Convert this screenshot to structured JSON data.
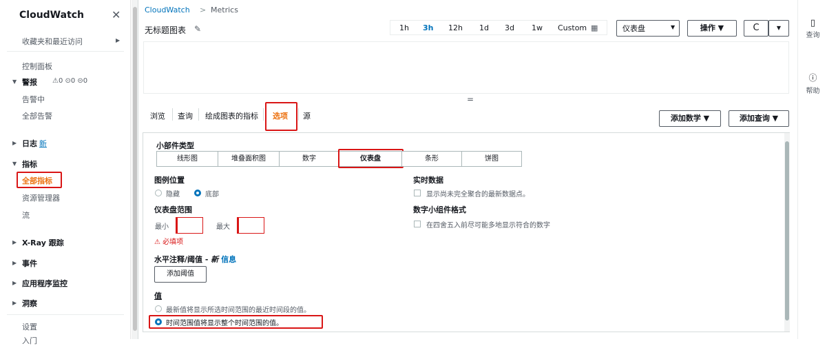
{
  "sidebar": {
    "title": "CloudWatch",
    "close": "✕",
    "favorites": "收藏夹和最近访问",
    "dashboard": "控制面板",
    "alarms": {
      "label": "警报",
      "counts": "⚠0 ⊙0 ⊝0"
    },
    "in_alarm": "告警中",
    "all_alarms": "全部告警",
    "logs": {
      "label": "日志",
      "badge": "新"
    },
    "metrics": "指标",
    "all_metrics": "全部指标",
    "explorer": "资源管理器",
    "streams": "流",
    "xray": "X-Ray 跟踪",
    "events": "事件",
    "app_monitoring": "应用程序监控",
    "insights": "洞察",
    "settings": "设置",
    "getting_started": "入门"
  },
  "breadcrumb": {
    "root": "CloudWatch",
    "separator": ">",
    "current": "Metrics"
  },
  "chart": {
    "title": "无标题图表",
    "edit_icon": "pencil-icon"
  },
  "timerange": {
    "options": [
      "1h",
      "3h",
      "12h",
      "1d",
      "3d",
      "1w",
      "Custom"
    ],
    "selected": "3h"
  },
  "toolbar": {
    "widget_select": "仪表盘",
    "actions": "操作 ▼",
    "refresh": "C",
    "refresh_dropdown": "▼"
  },
  "right_panel": {
    "query": "查询",
    "help": "帮助"
  },
  "resize_handle": "=",
  "tabs": [
    {
      "label": "浏览"
    },
    {
      "label": "查询"
    },
    {
      "label": "绘成图表的指标"
    },
    {
      "label": "选项"
    },
    {
      "label": "源"
    }
  ],
  "selected_tab": "选项",
  "add_math": "添加数学 ▼",
  "add_query": "添加查询 ▼",
  "options": {
    "widget_type_label": "小部件类型",
    "widget_types": [
      "线形图",
      "堆叠面积图",
      "数字",
      "仪表盘",
      "条形",
      "饼图"
    ],
    "selected_widget_type": "仪表盘",
    "legend_label": "图例位置",
    "legend_hidden": "隐藏",
    "legend_bottom": "底部",
    "gauge_range_label": "仪表盘范围",
    "min_label": "最小",
    "max_label": "最大",
    "required": "必填项",
    "annotation_label": "水平注释/阈值 - ",
    "annotation_new": "新",
    "annotation_info": "信息",
    "add_threshold": "添加阈值",
    "value_label": "值",
    "value_latest": "最新值将显示所选时间范围的最近时间段的值。",
    "value_timerange": "时间范围值将显示整个时间范围的值。",
    "live_data_label": "实时数据",
    "live_data_desc": "显示尚未完全聚合的最新数据点。",
    "number_format_label": "数字小组件格式",
    "number_format_desc": "在四舍五入前尽可能多地显示符合的数字"
  },
  "colors": {
    "accent": "#ec7211",
    "link": "#0073bb",
    "error": "#d91515"
  }
}
